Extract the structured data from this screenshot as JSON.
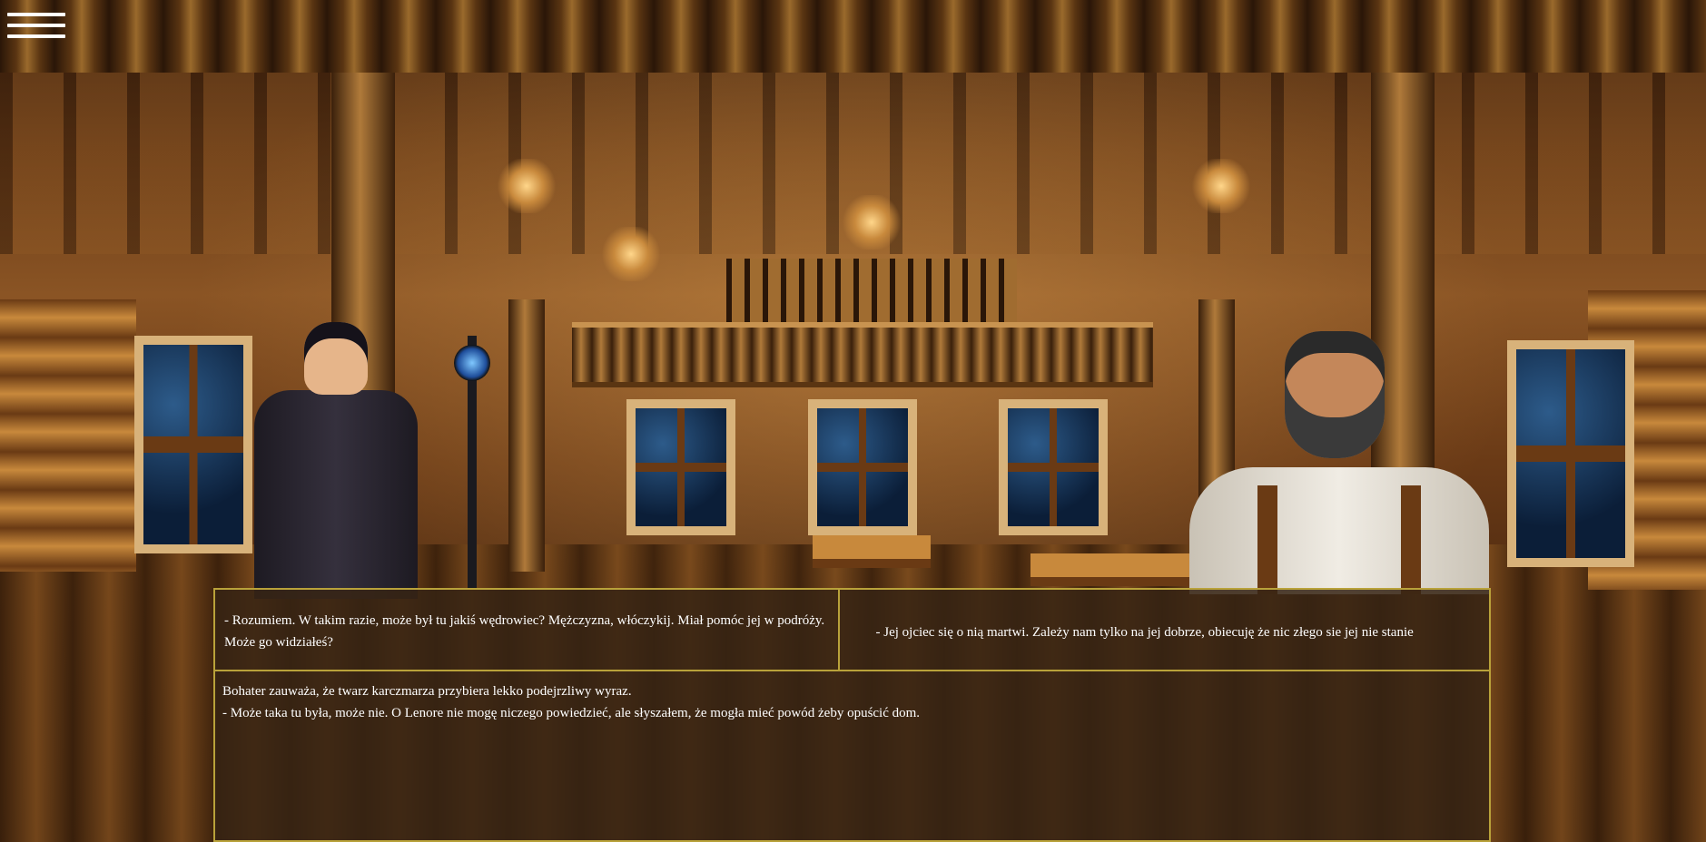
{
  "game": {
    "menu_icon": "hamburger-menu-icon"
  },
  "choices": [
    {
      "text": "- Rozumiem. W takim razie, może był tu jakiś wędrowiec? Mężczyzna, włóczykij. Miał pomóc jej w podróży. Może go widziałeś?"
    },
    {
      "text": "- Jej ojciec się o nią martwi. Zależy nam tylko na jej dobrze, obiecuję że nic złego sie jej nie stanie"
    }
  ],
  "narration": {
    "line1": "Bohater zauważa, że twarz karczmarza przybiera lekko podejrzliwy wyraz.",
    "line2": "- Może taka tu była, może nie. O Lenore nie mogę niczego powiedzieć, ale słyszałem, że mogła mieć powód żeby opuścić dom."
  },
  "colors": {
    "panel_bg": "#372414",
    "panel_border": "#b9a23a",
    "text": "#ffffff"
  }
}
